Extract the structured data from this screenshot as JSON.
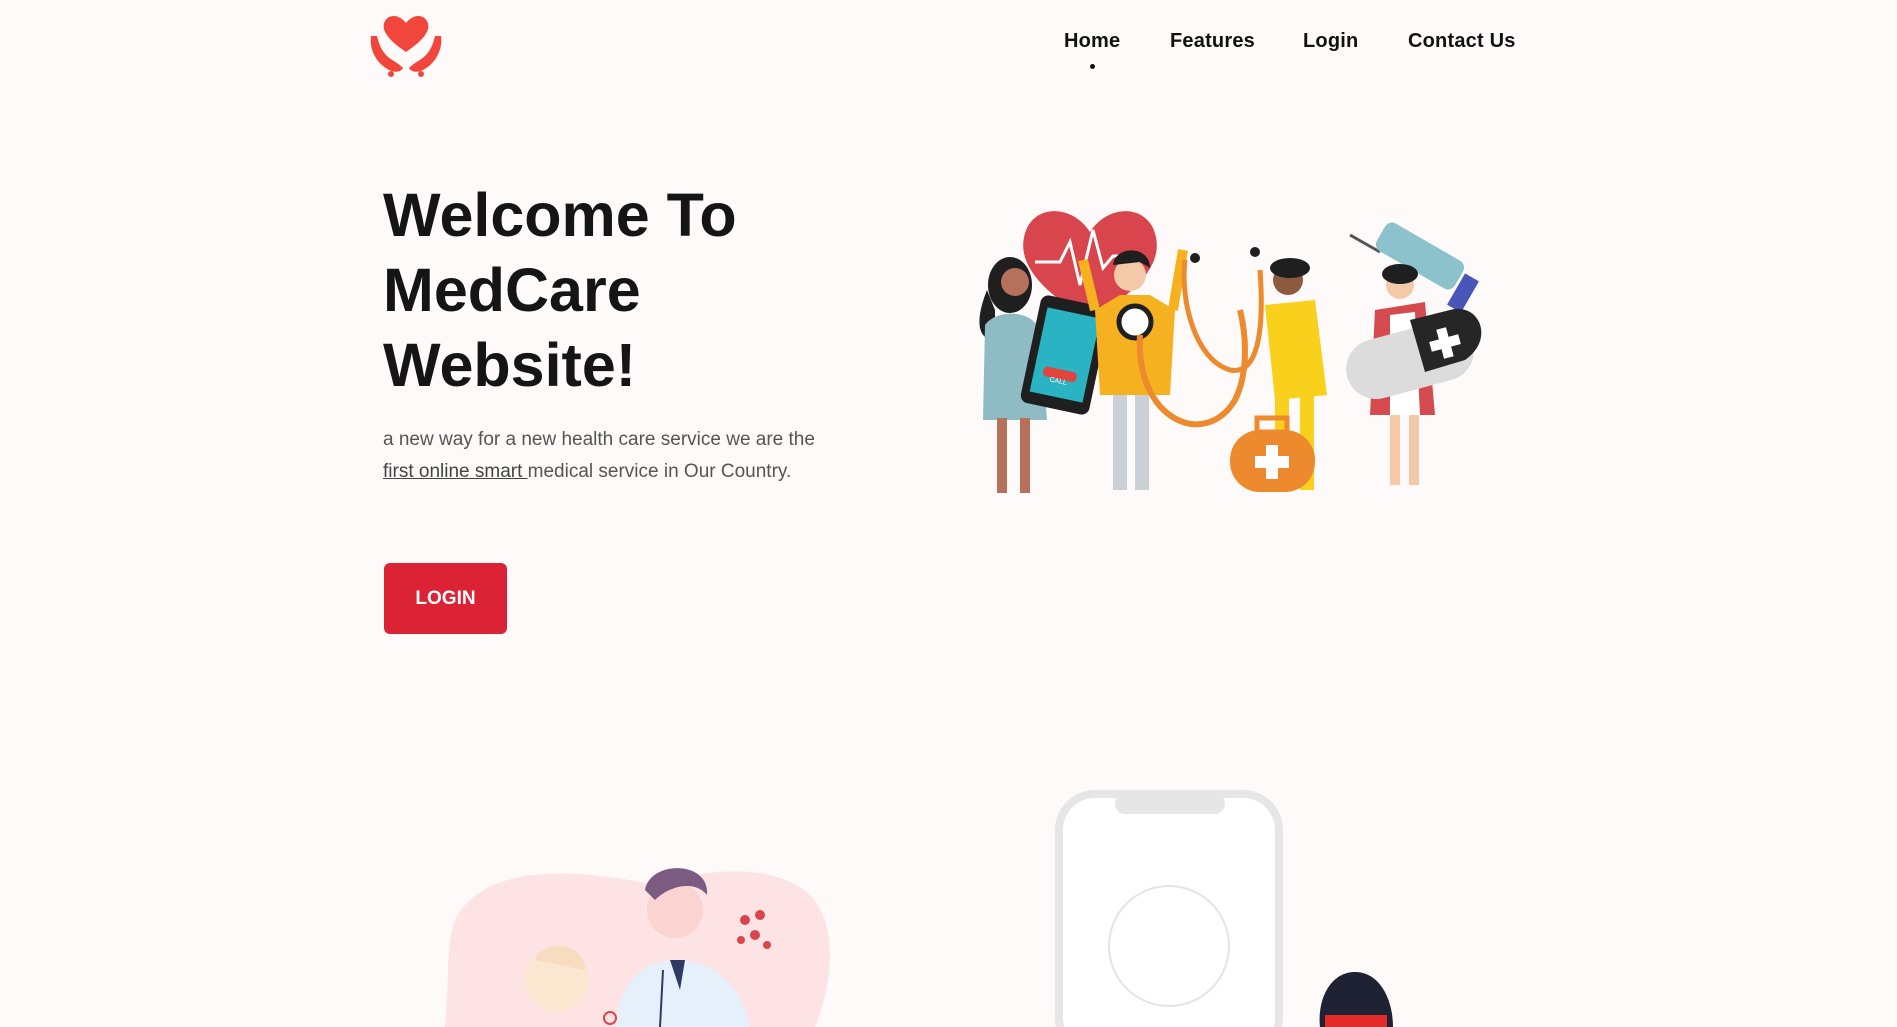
{
  "brand": {
    "logo_icon": "heart-hands-icon",
    "color": "#f0463c"
  },
  "nav": {
    "items": [
      {
        "label": "Home",
        "active": true
      },
      {
        "label": "Features",
        "active": false
      },
      {
        "label": "Login",
        "active": false
      },
      {
        "label": "Contact Us",
        "active": false
      }
    ]
  },
  "hero": {
    "title_line1": "Welcome To",
    "title_line2": "MedCare",
    "title_line3": "Website!",
    "sub_pre": "a new way for a new health care service we are the ",
    "sub_link": "first online smart ",
    "sub_post": "medical service in Our Country.",
    "button_label": "LOGIN",
    "button_color": "#dc2235",
    "phone_screen_label": "CALL"
  },
  "icons": [
    "heart-hands-icon",
    "heart-pulse-icon",
    "syringe-icon",
    "stethoscope-icon",
    "first-aid-kit-icon",
    "pill-icon",
    "phone-icon"
  ]
}
